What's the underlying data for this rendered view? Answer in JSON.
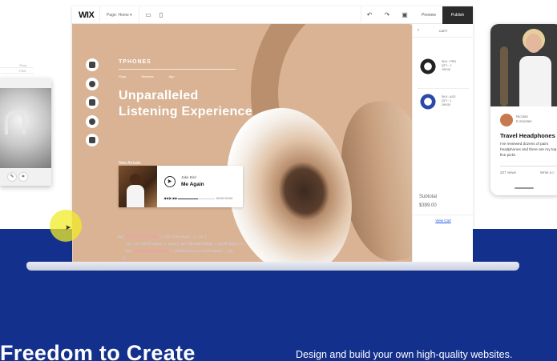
{
  "editor": {
    "logo": "WIX",
    "page_select": "Page: Home",
    "preview_label": "Preview",
    "publish_label": "Publish"
  },
  "site": {
    "brand": "TPHONES",
    "nav": [
      "Shop",
      "Reviews",
      "App"
    ],
    "headline_line1": "Unparalleled",
    "headline_line2": "Listening Experience",
    "new_arrivals": "New Arrivals",
    "player": {
      "artist": "Jake Bird",
      "song": "Me Again",
      "controls": "◀◀  ▶  ▶▶",
      "time": "00:00  03:04",
      "progress": 0.55
    }
  },
  "cart": {
    "title": "CART",
    "items": [
      {
        "text": "SKU : PRO\nQTY : 1\n199.00"
      },
      {
        "text": "SKU : ACE\nQTY : 1\n199.00"
      }
    ],
    "subtotal_label": "Subtotal",
    "subtotal_value": "$399.00",
    "view_cart": "View Cart"
  },
  "phone": {
    "author": "Nicolas\n5 minutes",
    "post_title": "Travel Headphones",
    "post_body": "I've reviewed dozens of pairs headphones and there are my top five picks",
    "views": "207 views",
    "write": "Write a c"
  },
  "code": {
    "line1_pre": "$w('",
    "line1_fn": "#addToCartButton",
    "line1_post": "').onClick(async () => {",
    "line2": "    let currentProduct = await $w('#productPage').getProduct();",
    "line3_pre": "    $w('",
    "line3_fn": "#shoppingCartIcon",
    "line3_post": "').addToCart(currentProduct._id);",
    "line4": "  })"
  },
  "hero": {
    "title": "Freedom to Create",
    "subtitle": "Design and build your own high-quality websites."
  },
  "left_card": {
    "tabs": [
      "Shop",
      "Filter"
    ]
  }
}
